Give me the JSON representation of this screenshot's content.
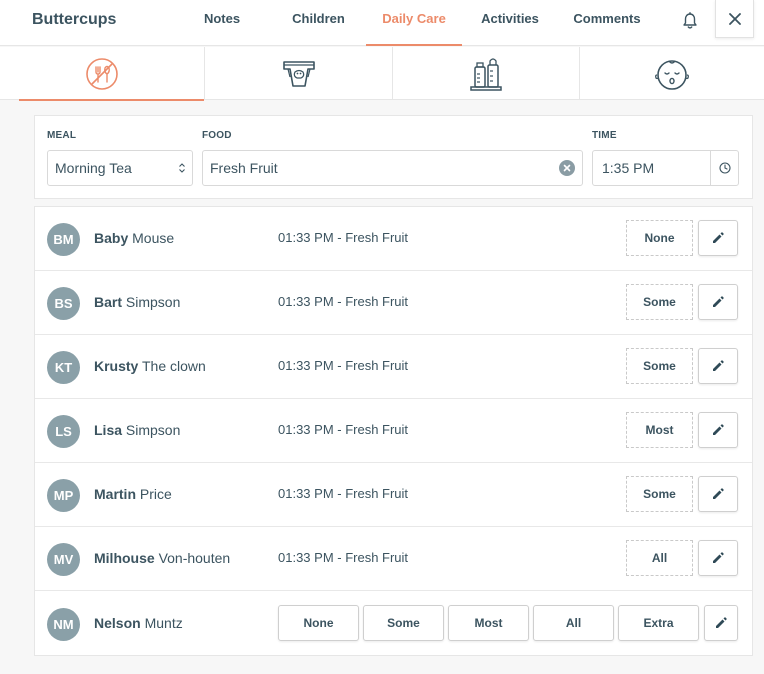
{
  "header": {
    "title": "Buttercups",
    "tabs": [
      {
        "label": "Notes"
      },
      {
        "label": "Children"
      },
      {
        "label": "Daily Care",
        "active": true
      },
      {
        "label": "Activities"
      },
      {
        "label": "Comments"
      }
    ],
    "icons": {
      "notifications": "bell-icon",
      "close": "close-icon"
    }
  },
  "care_types": [
    {
      "icon": "meal-icon",
      "active": true
    },
    {
      "icon": "nappy-icon"
    },
    {
      "icon": "bottles-icon"
    },
    {
      "icon": "sleep-face-icon"
    }
  ],
  "form": {
    "meal_label": "MEAL",
    "meal_value": "Morning Tea",
    "food_label": "FOOD",
    "food_value": "Fresh Fruit",
    "time_label": "TIME",
    "time_value": "1:35 PM"
  },
  "children": [
    {
      "initials": "BM",
      "first": "Baby",
      "last": "Mouse",
      "entry": "01:33 PM - Fresh Fruit",
      "amount": "None"
    },
    {
      "initials": "BS",
      "first": "Bart",
      "last": "Simpson",
      "entry": "01:33 PM - Fresh Fruit",
      "amount": "Some"
    },
    {
      "initials": "KT",
      "first": "Krusty",
      "last": "The clown",
      "entry": "01:33 PM - Fresh Fruit",
      "amount": "Some"
    },
    {
      "initials": "LS",
      "first": "Lisa",
      "last": "Simpson",
      "entry": "01:33 PM - Fresh Fruit",
      "amount": "Most"
    },
    {
      "initials": "MP",
      "first": "Martin",
      "last": "Price",
      "entry": "01:33 PM - Fresh Fruit",
      "amount": "Some"
    },
    {
      "initials": "MV",
      "first": "Milhouse",
      "last": "Von-houten",
      "entry": "01:33 PM - Fresh Fruit",
      "amount": "All"
    },
    {
      "initials": "NM",
      "first": "Nelson",
      "last": "Muntz"
    }
  ],
  "amount_options": [
    "None",
    "Some",
    "Most",
    "All",
    "Extra"
  ],
  "colors": {
    "accent": "#ec8b6a",
    "text": "#3c5460",
    "avatar": "#8aa0a8"
  }
}
